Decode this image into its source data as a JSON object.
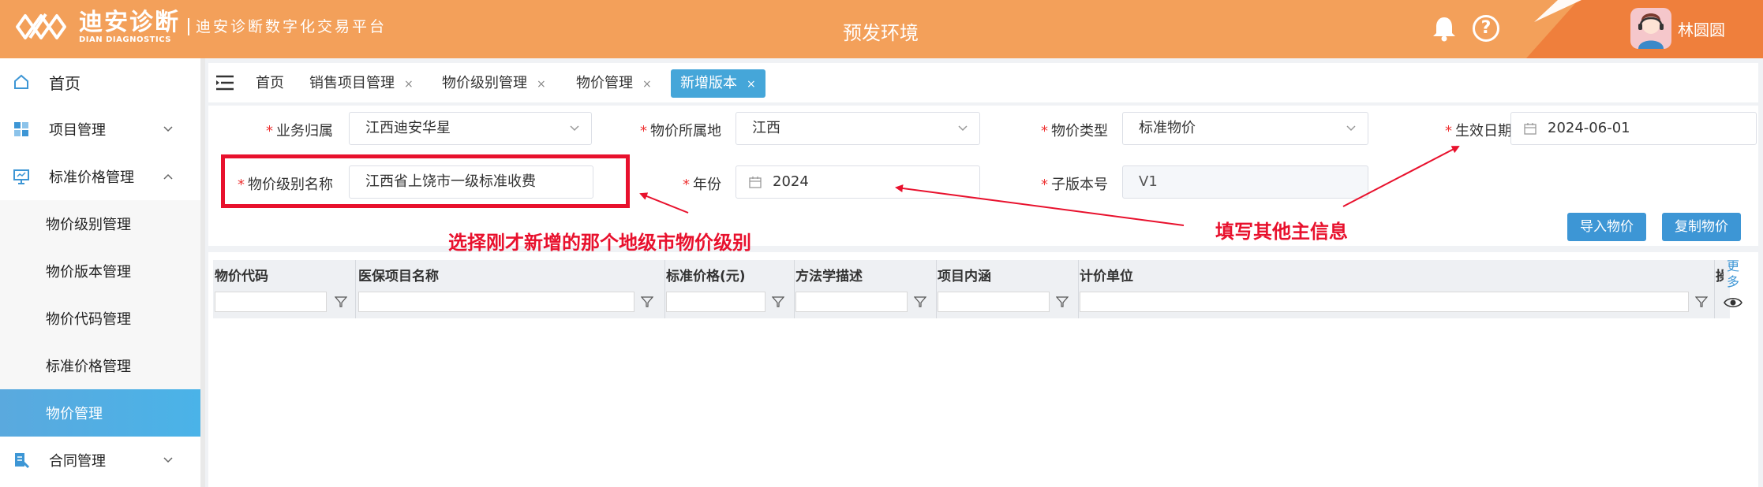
{
  "header": {
    "logo_main": "迪安诊断",
    "logo_sub": "DIAN DIAGNOSTICS",
    "platform_name": "迪安诊断数字化交易平台",
    "env_title": "预发环境",
    "help_glyph": "?",
    "user_name": "林圆圆",
    "colors": {
      "bar": "#f3a05a",
      "accent": "#ef7f3c"
    }
  },
  "sidebar": {
    "items": [
      {
        "label": "首页",
        "icon": "home-icon"
      },
      {
        "label": "项目管理",
        "icon": "grid-icon"
      },
      {
        "label": "标准价格管理",
        "icon": "monitor-icon",
        "expanded": true
      },
      {
        "label": "合同管理",
        "icon": "contract-icon"
      }
    ],
    "sub_items": [
      {
        "label": "物价级别管理"
      },
      {
        "label": "物价版本管理"
      },
      {
        "label": "物价代码管理"
      },
      {
        "label": "标准价格管理"
      },
      {
        "label": "物价管理",
        "active": true
      }
    ]
  },
  "tabs": [
    {
      "label": "首页"
    },
    {
      "label": "销售项目管理",
      "close": "×"
    },
    {
      "label": "物价级别管理",
      "close": "×"
    },
    {
      "label": "物价管理",
      "close": "×"
    },
    {
      "label": "新增版本",
      "close": "×",
      "active": true
    }
  ],
  "form": {
    "business_unit": {
      "label": "业务归属",
      "value": "江西迪安华星"
    },
    "price_region": {
      "label": "物价所属地",
      "value": "江西"
    },
    "price_type": {
      "label": "物价类型",
      "value": "标准物价"
    },
    "effective_date": {
      "label": "生效日期",
      "value": "2024-06-01"
    },
    "price_level_name": {
      "label": "物价级别名称",
      "value": "江西省上饶市一级标准收费"
    },
    "year": {
      "label": "年份",
      "value": "2024"
    },
    "sub_version": {
      "label": "子版本号",
      "value": "V1"
    },
    "required_mark": "*"
  },
  "buttons": {
    "import": "导入物价",
    "copy": "复制物价"
  },
  "grid": {
    "columns": [
      "物价代码",
      "医保项目名称",
      "标准价格(元)",
      "方法学描述",
      "项目内涵",
      "计价单位"
    ],
    "clipped_col": "操",
    "more": "更多"
  },
  "annotations": {
    "left_note": "选择刚才新增的那个地级市物价级别",
    "right_note": "填写其他主信息",
    "color": "#e8112d"
  }
}
